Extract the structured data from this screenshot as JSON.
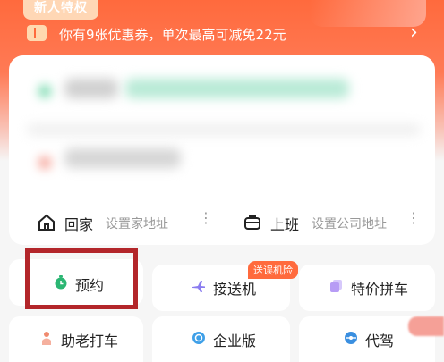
{
  "header": {
    "badge": "新人特权",
    "coupon_text": "你有9张优惠券，单次最高可减免22元",
    "coupon_arrow": "›"
  },
  "address": {
    "home_title": "回家",
    "home_sub": "设置家地址",
    "work_title": "上班",
    "work_sub": "设置公司地址",
    "more": "⋮"
  },
  "services": [
    {
      "label": "预约",
      "icon": "clock-icon",
      "color": "#2bb673"
    },
    {
      "label": "接送机",
      "icon": "plane-icon",
      "color": "#8a7cf0",
      "tag": "送误机险"
    },
    {
      "label": "特价拼车",
      "icon": "carpool-icon",
      "color": "#b79cf5"
    },
    {
      "label": "助老打车",
      "icon": "elder-icon",
      "color": "#f08a6e"
    },
    {
      "label": "企业版",
      "icon": "enterprise-icon",
      "color": "#3fa0e8"
    },
    {
      "label": "代驾",
      "icon": "steering-icon",
      "color": "#3a8fe0"
    }
  ],
  "colors": {
    "accent": "#ff6a3d",
    "highlight": "#b3262a"
  }
}
